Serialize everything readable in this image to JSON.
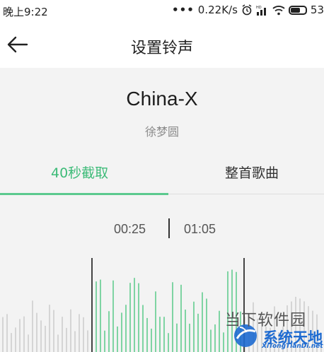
{
  "status_bar": {
    "time": "晚上9:22",
    "network_speed": "0.22K/s",
    "battery": "53"
  },
  "header": {
    "title": "设置铃声",
    "back_icon": "arrow-left-icon"
  },
  "song": {
    "title": "China-X",
    "artist": "徐梦圆"
  },
  "tabs": [
    {
      "label": "40秒截取",
      "active": true
    },
    {
      "label": "整首歌曲",
      "active": false
    }
  ],
  "range": {
    "start": "00:25",
    "end": "01:05"
  },
  "colors": {
    "accent": "#3dbb78",
    "wave_selected": "#7fd4a3",
    "wave_unselected": "#d5d5d5"
  },
  "watermark": {
    "line1": "当下软件园",
    "line2": "系统天地",
    "line3": "XiTongTianDi.net"
  }
}
